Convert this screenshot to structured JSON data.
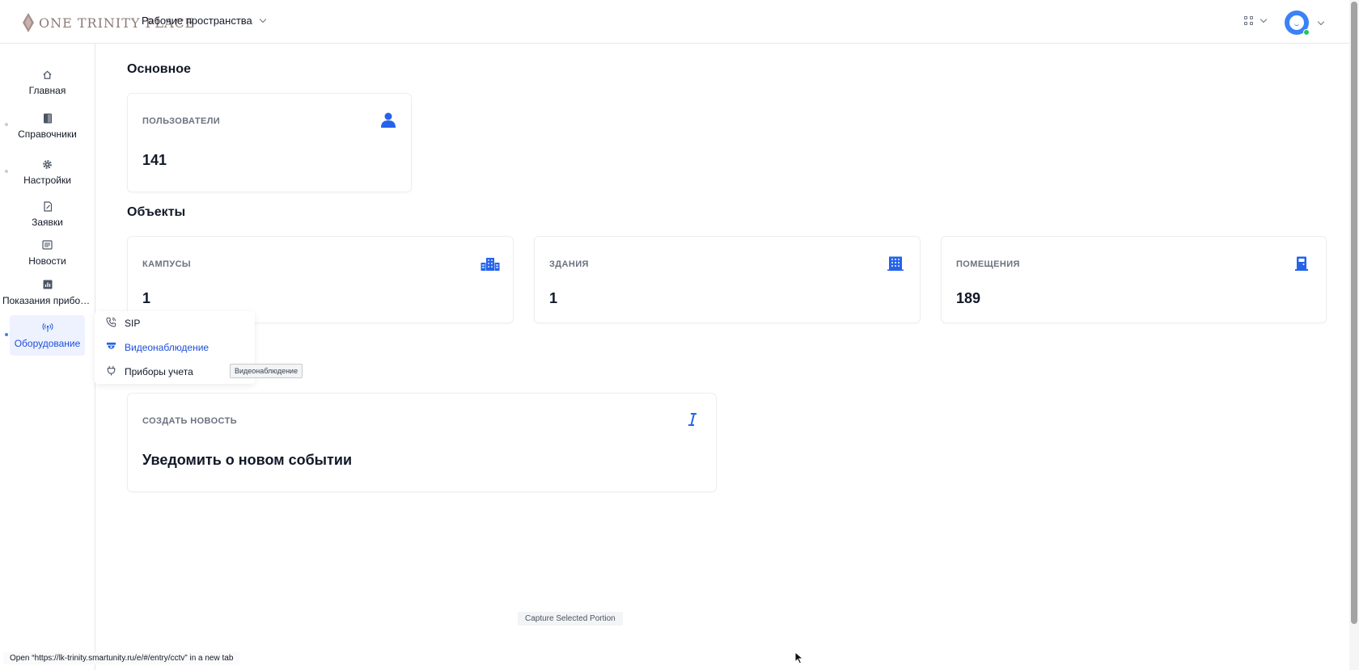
{
  "header": {
    "logo_text": "ONE TRINITY PLACE",
    "workspaces_label": "Рабочие пространства"
  },
  "sidebar": {
    "items": [
      {
        "label": "Главная",
        "icon": "home-icon"
      },
      {
        "label": "Справочники",
        "icon": "book-icon"
      },
      {
        "label": "Настройки",
        "icon": "gear-icon"
      },
      {
        "label": "Заявки",
        "icon": "document-icon"
      },
      {
        "label": "Новости",
        "icon": "newspaper-icon"
      },
      {
        "label": "Показания приборов",
        "icon": "chart-icon"
      },
      {
        "label": "Оборудование",
        "icon": "antenna-icon",
        "active": true
      }
    ]
  },
  "flyout": {
    "items": [
      {
        "label": "SIP",
        "icon": "phone-icon"
      },
      {
        "label": "Видеонаблюдение",
        "icon": "cctv-icon",
        "active": true
      },
      {
        "label": "Приборы учета",
        "icon": "plug-icon"
      }
    ],
    "tooltip": "Видеонаблюдение"
  },
  "main": {
    "section_basic": "Основное",
    "users": {
      "label": "ПОЛЬЗОВАТЕЛИ",
      "value": "141"
    },
    "section_objects": "Объекты",
    "campuses": {
      "label": "КАМПУСЫ",
      "value": "1"
    },
    "buildings": {
      "label": "ЗДАНИЯ",
      "value": "1"
    },
    "rooms": {
      "label": "ПОМЕЩЕНИЯ",
      "value": "189"
    },
    "news": {
      "label": "СОЗДАТЬ НОВОСТЬ",
      "value": "Уведомить о новом событии"
    }
  },
  "overlay": {
    "capture_label": "Capture Selected Portion",
    "status_text": "Open “https://lk-trinity.smartunity.ru/e/#/entry/cctv” in a new tab"
  },
  "colors": {
    "accent": "#2563eb",
    "active_bg": "#eef2ff",
    "logo": "#8a7a78"
  }
}
